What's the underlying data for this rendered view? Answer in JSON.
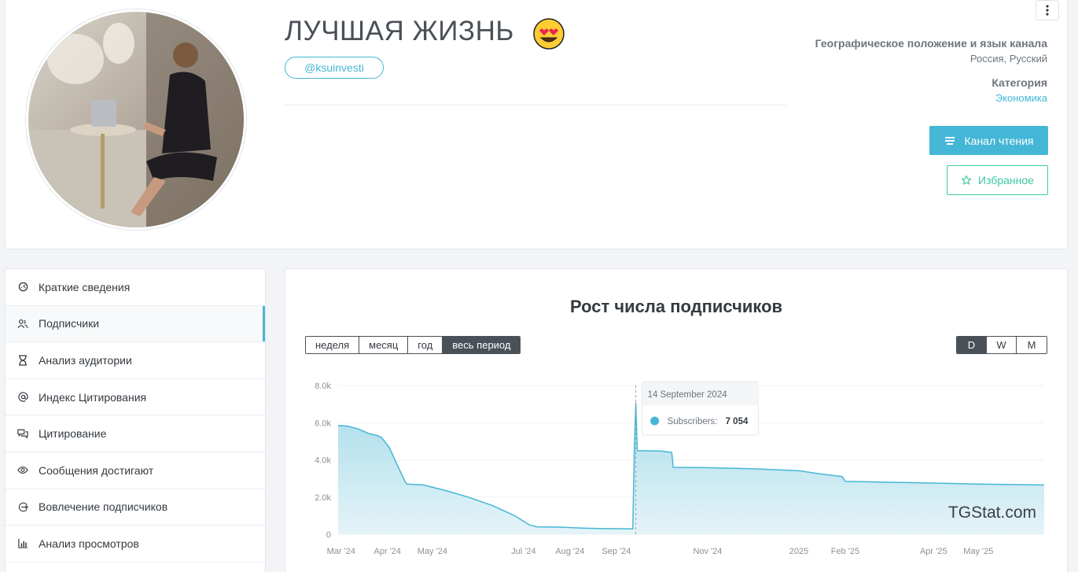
{
  "channel": {
    "title": "ЛУЧШАЯ ЖИЗНЬ",
    "username": "@ksuinvesti",
    "geo_label": "Географическое положение и язык канала",
    "geo_value": "Россия, Русский",
    "category_label": "Категория",
    "category_value": "Экономика",
    "read_button": "Канал чтения",
    "favorite_button": "Избранное"
  },
  "colors": {
    "accent": "#45b7d6",
    "success": "#3ec8a1",
    "dark": "#495057"
  },
  "sidebar": {
    "items": [
      {
        "label": "Краткие сведения",
        "icon": "dashboard-icon",
        "active": false
      },
      {
        "label": "Подписчики",
        "icon": "users-icon",
        "active": true
      },
      {
        "label": "Анализ аудитории",
        "icon": "hourglass-icon",
        "active": false
      },
      {
        "label": "Индекс Цитирования",
        "icon": "at-icon",
        "active": false
      },
      {
        "label": "Цитирование",
        "icon": "quote-icon",
        "active": false
      },
      {
        "label": "Сообщения достигают",
        "icon": "eye-icon",
        "active": false
      },
      {
        "label": "Вовлечение подписчиков",
        "icon": "engagement-icon",
        "active": false
      },
      {
        "label": "Анализ просмотров",
        "icon": "bar-chart-icon",
        "active": false
      }
    ]
  },
  "chart_panel": {
    "title": "Рост числа подписчиков",
    "periods": [
      {
        "label": "неделя",
        "on": false
      },
      {
        "label": "месяц",
        "on": false
      },
      {
        "label": "год",
        "on": false
      },
      {
        "label": "весь период",
        "on": true
      }
    ],
    "granularity": [
      {
        "label": "D",
        "on": true
      },
      {
        "label": "W",
        "on": false
      },
      {
        "label": "M",
        "on": false
      }
    ],
    "watermark": "TGStat.com",
    "tooltip": {
      "date": "14 September 2024",
      "series": "Subscribers:",
      "value": "7 054"
    }
  },
  "chart_data": {
    "type": "area",
    "title": "Рост числа подписчиков",
    "xlabel": "",
    "ylabel": "",
    "ylim": [
      0,
      8000
    ],
    "yticks": [
      {
        "value": 0,
        "label": "0"
      },
      {
        "value": 2000,
        "label": "2.0k"
      },
      {
        "value": 4000,
        "label": "4.0k"
      },
      {
        "value": 6000,
        "label": "6.0k"
      },
      {
        "value": 8000,
        "label": "8.0k"
      }
    ],
    "xlim": [
      "2024-02-28",
      "2025-06-14"
    ],
    "xticks": [
      {
        "date": "2024-03-01",
        "label": "Mar '24"
      },
      {
        "date": "2024-04-01",
        "label": "Apr '24"
      },
      {
        "date": "2024-05-01",
        "label": "May '24"
      },
      {
        "date": "2024-07-01",
        "label": "Jul '24"
      },
      {
        "date": "2024-08-01",
        "label": "Aug '24"
      },
      {
        "date": "2024-09-01",
        "label": "Sep '24"
      },
      {
        "date": "2024-11-01",
        "label": "Nov '24"
      },
      {
        "date": "2025-01-01",
        "label": "2025"
      },
      {
        "date": "2025-02-01",
        "label": "Feb '25"
      },
      {
        "date": "2025-04-01",
        "label": "Apr '25"
      },
      {
        "date": "2025-05-01",
        "label": "May '25"
      }
    ],
    "grid": true,
    "series": [
      {
        "color": "#45b7d6",
        "points": [
          [
            "2024-02-28",
            5850
          ],
          [
            "2024-03-05",
            5820
          ],
          [
            "2024-03-12",
            5680
          ],
          [
            "2024-03-20",
            5400
          ],
          [
            "2024-03-25",
            5320
          ],
          [
            "2024-03-28",
            5200
          ],
          [
            "2024-04-02",
            4700
          ],
          [
            "2024-04-06",
            4000
          ],
          [
            "2024-04-10",
            3300
          ],
          [
            "2024-04-13",
            2800
          ],
          [
            "2024-04-14",
            2700
          ],
          [
            "2024-04-25",
            2650
          ],
          [
            "2024-05-10",
            2350
          ],
          [
            "2024-05-25",
            2000
          ],
          [
            "2024-06-10",
            1550
          ],
          [
            "2024-06-25",
            1000
          ],
          [
            "2024-07-05",
            500
          ],
          [
            "2024-07-10",
            400
          ],
          [
            "2024-07-25",
            380
          ],
          [
            "2024-08-10",
            330
          ],
          [
            "2024-08-25",
            300
          ],
          [
            "2024-09-12",
            290
          ],
          [
            "2024-09-13",
            4500
          ],
          [
            "2024-09-14",
            7054
          ],
          [
            "2024-09-15",
            4500
          ],
          [
            "2024-10-01",
            4480
          ],
          [
            "2024-10-08",
            4400
          ],
          [
            "2024-10-09",
            3600
          ],
          [
            "2024-11-01",
            3580
          ],
          [
            "2024-12-01",
            3520
          ],
          [
            "2025-01-01",
            3420
          ],
          [
            "2025-01-15",
            3250
          ],
          [
            "2025-01-30",
            3100
          ],
          [
            "2025-02-01",
            2850
          ],
          [
            "2025-03-01",
            2800
          ],
          [
            "2025-04-01",
            2750
          ],
          [
            "2025-05-01",
            2700
          ],
          [
            "2025-06-14",
            2650
          ]
        ]
      }
    ]
  }
}
